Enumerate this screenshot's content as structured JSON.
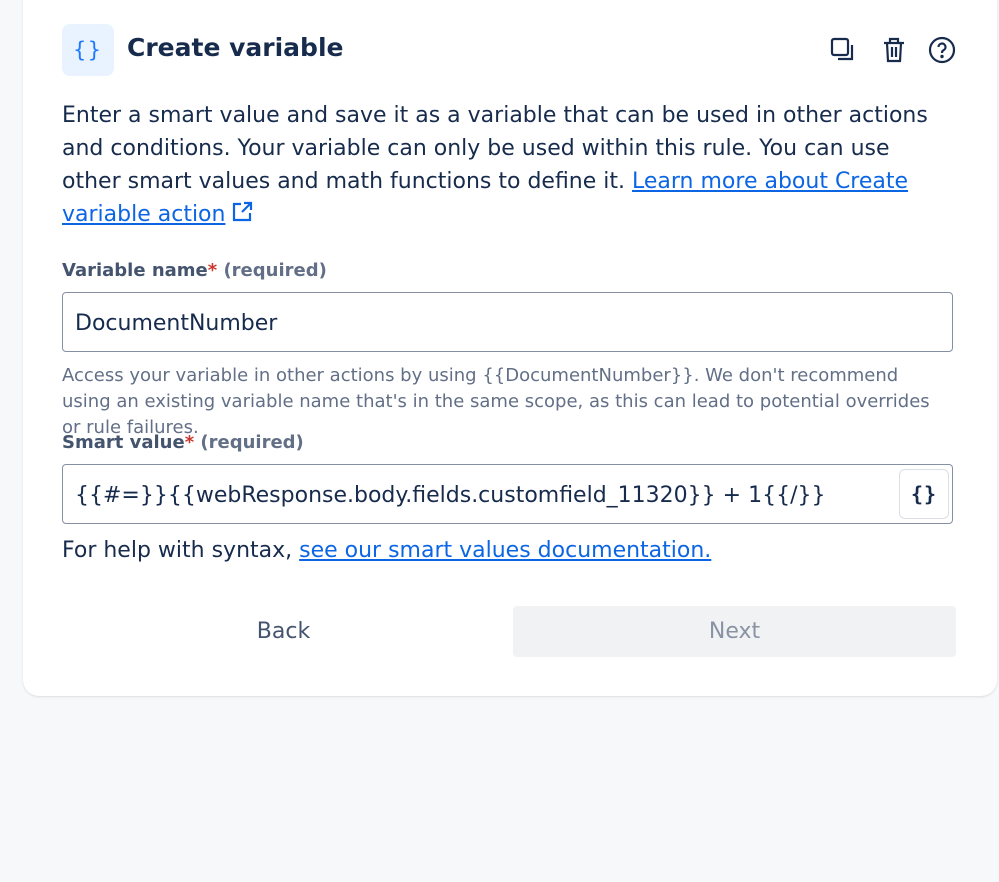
{
  "header": {
    "icon": "curly-braces-icon",
    "title": "Create variable",
    "actions": [
      "duplicate-icon",
      "trash-icon",
      "help-icon"
    ]
  },
  "description": {
    "text": "Enter a smart value and save it as a variable that can be used in other actions and conditions. Your variable can only be used within this rule. You can use other smart values and math functions to define it. ",
    "link": "Learn more about Create variable action"
  },
  "variable_name": {
    "label": "Variable name",
    "required_mark": "*",
    "required_text": "(required)",
    "value": "DocumentNumber",
    "hint": "Access your variable in other actions by using {{DocumentNumber}}. We don't recommend using an existing variable name that's in the same scope, as this can lead to potential overrides or rule failures."
  },
  "smart_value": {
    "label": "Smart value",
    "required_mark": "*",
    "required_text": "(required)",
    "value": "{{#=}}{{webResponse.body.fields.customfield_11320}} + 1{{/}}",
    "insert_button": "{}"
  },
  "help": {
    "prefix": "For help with syntax, ",
    "link": "see our smart values documentation."
  },
  "buttons": {
    "back": "Back",
    "next": "Next"
  },
  "colors": {
    "link": "#0c66e4",
    "required": "#c9372c",
    "icon_bg": "#e9f2ff",
    "icon_fg": "#1d7afc"
  }
}
